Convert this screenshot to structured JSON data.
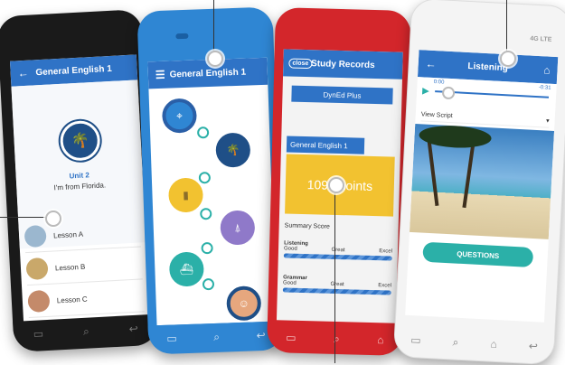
{
  "screens": [
    {
      "title": "General English 1",
      "unit_label": "Unit 2",
      "unit_subtitle": "I'm from Florida.",
      "lessons": [
        {
          "label": "Lesson A"
        },
        {
          "label": "Lesson B"
        },
        {
          "label": "Lesson C"
        }
      ]
    },
    {
      "title": "General English 1"
    },
    {
      "title": "Study Records",
      "close_label": "close",
      "product_label": "DynEd Plus",
      "course_label": "General English 1",
      "points_text": "1097 points",
      "summary_label": "Summary Score",
      "scores": [
        {
          "name": "Listening",
          "levels": [
            "Good",
            "Great",
            "Excel"
          ]
        },
        {
          "name": "Grammar",
          "levels": [
            "Good",
            "Great",
            "Excel"
          ]
        }
      ]
    },
    {
      "title": "Listening",
      "network_label": "4G LTE",
      "time_start": "0:00",
      "time_end": "-0:31",
      "view_script_label": "View Script",
      "questions_label": "QUESTIONS"
    }
  ],
  "colors": {
    "app_blue": "#2f73c6",
    "teal": "#2bb0a8",
    "yellow": "#f2c230",
    "phone_red": "#d3262b",
    "phone_blue": "#2f86d3"
  }
}
